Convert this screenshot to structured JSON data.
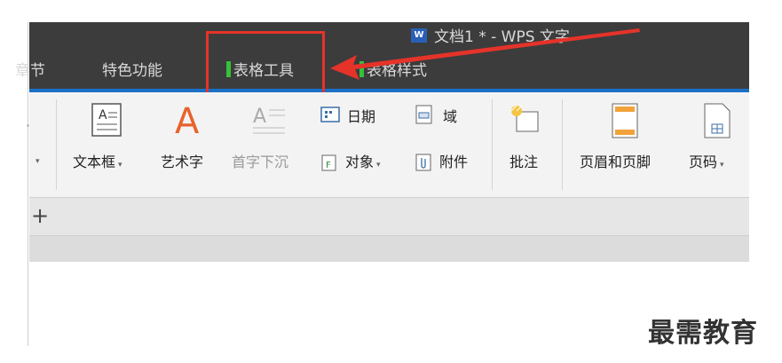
{
  "window": {
    "title": "文档1 * - WPS 文字",
    "doc_icon": "W"
  },
  "tabs": {
    "partial": "章节",
    "special": "特色功能",
    "table_tools": "表格工具",
    "table_style": "表格样式"
  },
  "ribbon": {
    "textbox": "文本框",
    "wordart": "艺术字",
    "dropcap": "首字下沉",
    "date": "日期",
    "field": "域",
    "object": "对象",
    "attachment": "附件",
    "comment": "批注",
    "header_footer": "页眉和页脚",
    "page_number": "页码"
  },
  "watermark": "最需教育",
  "colors": {
    "accent_red": "#e5332a",
    "tab_green": "#35c13a",
    "ribbon_blue": "#1c70c6"
  }
}
